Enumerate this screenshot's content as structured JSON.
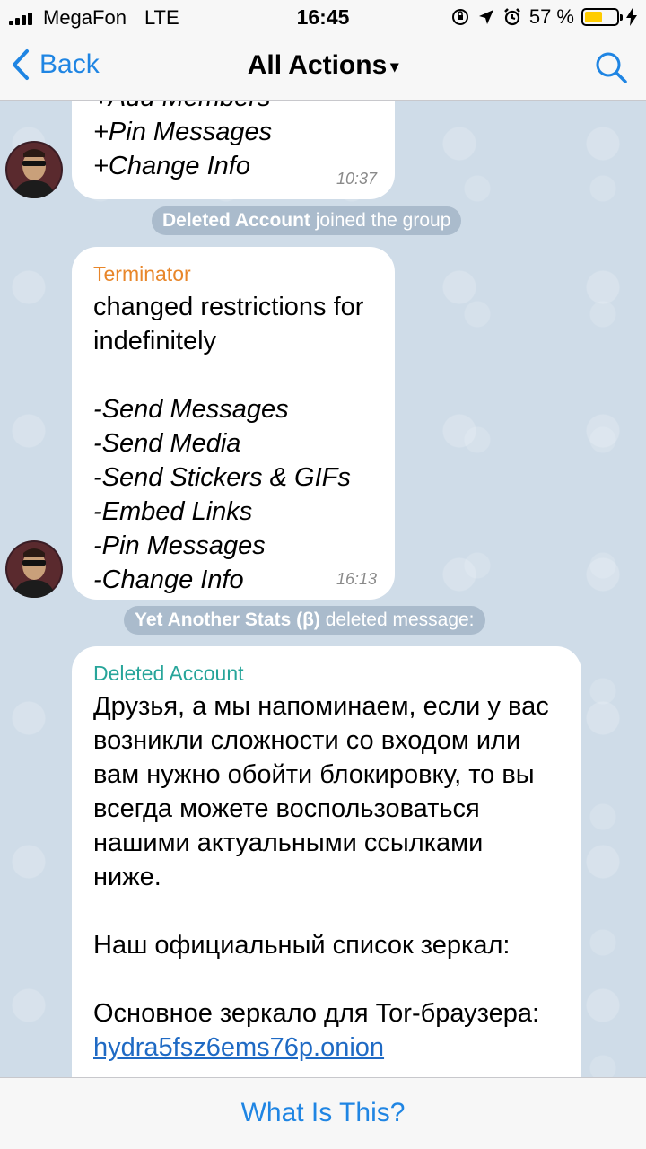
{
  "status_bar": {
    "carrier": "MegaFon",
    "network": "LTE",
    "time": "16:45",
    "battery_percent": "57 %",
    "battery_level": 0.57,
    "icons": [
      "signal-icon",
      "screen-rotation-lock-icon",
      "location-icon",
      "alarm-icon",
      "battery-icon",
      "charging-bolt-icon"
    ]
  },
  "nav": {
    "back_label": "Back",
    "title": "All Actions",
    "title_caret": "▾",
    "search_icon": "search-icon"
  },
  "messages": {
    "msg1": {
      "lines_top": "+Add Members",
      "text": "+Pin Messages\n+Change Info",
      "time": "10:37"
    },
    "service1": {
      "name": "Deleted Account",
      "action": " joined the group"
    },
    "msg2": {
      "sender": "Terminator",
      "sender_color": "#e8862a",
      "intro": "changed restrictions for\nindefinitely",
      "restrictions": "-Send Messages\n-Send Media\n-Send Stickers & GIFs\n-Embed Links\n-Pin Messages\n-Change Info",
      "time": "16:13"
    },
    "service2": {
      "name": "Yet Another Stats (β)",
      "action": " deleted message:"
    },
    "msg3": {
      "sender": "Deleted Account",
      "sender_color": "#27a59a",
      "paragraph1": "Друзья, а мы напоминаем, если у вас\nвозникли сложности со входом или\nвам нужно обойти блокировку, то вы\nвсегда можете воспользоваться\nнашими актуальными ссылками\nниже.",
      "paragraph2": "Наш официальный список зеркал:",
      "paragraph3": "Основное зеркало для Tor-браузера:",
      "link": "hydra5fsz6ems76p.onion"
    }
  },
  "bottom": {
    "label": "What Is This?"
  },
  "colors": {
    "accent": "#1f85e3",
    "chat_background": "#cfdce8",
    "bubble": "#ffffff"
  }
}
